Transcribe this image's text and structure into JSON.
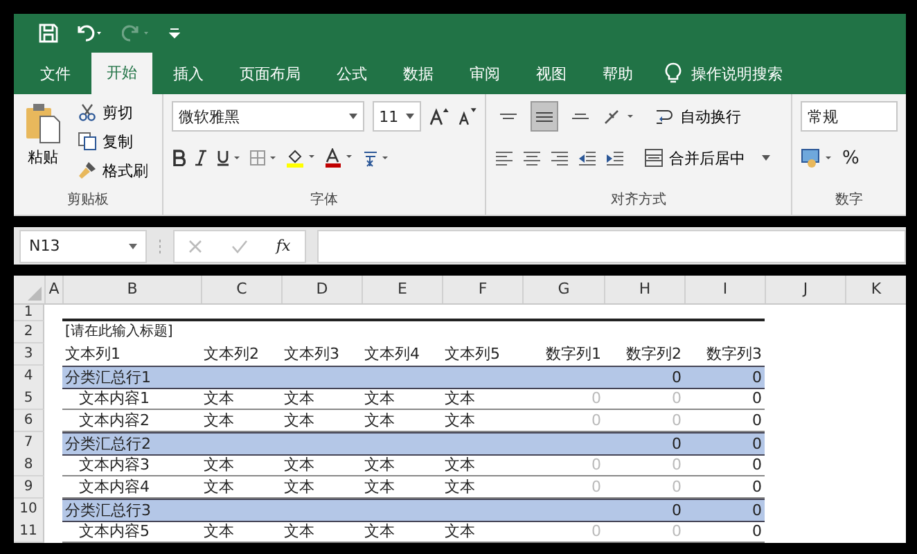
{
  "quick_access": {
    "redo_disabled": true
  },
  "tabs": [
    {
      "label": "文件",
      "selected": false
    },
    {
      "label": "开始",
      "selected": true
    },
    {
      "label": "插入",
      "selected": false
    },
    {
      "label": "页面布局",
      "selected": false
    },
    {
      "label": "公式",
      "selected": false
    },
    {
      "label": "数据",
      "selected": false
    },
    {
      "label": "审阅",
      "selected": false
    },
    {
      "label": "视图",
      "selected": false
    },
    {
      "label": "帮助",
      "selected": false
    }
  ],
  "tell_me": "操作说明搜索",
  "clipboard": {
    "paste": "粘贴",
    "cut": "剪切",
    "copy": "复制",
    "format_painter": "格式刷",
    "label": "剪贴板"
  },
  "font": {
    "name": "微软雅黑",
    "size": "11",
    "label": "字体"
  },
  "alignment": {
    "vertical": [
      {
        "kind": "top",
        "selected": false
      },
      {
        "kind": "middle",
        "selected": true
      },
      {
        "kind": "bottom",
        "selected": false
      }
    ],
    "wrap": "自动换行",
    "merge": "合并后居中",
    "label": "对齐方式"
  },
  "number": {
    "format": "常规",
    "percent": "%",
    "label": "数字"
  },
  "formula_bar": {
    "name_box": "N13",
    "fx": "fx"
  },
  "columns": [
    "A",
    "B",
    "C",
    "D",
    "E",
    "F",
    "G",
    "H",
    "I",
    "J",
    "K"
  ],
  "rows": [
    {
      "number": "1",
      "kind": "blank",
      "cells": []
    },
    {
      "number": "2",
      "kind": "title",
      "cells": [
        {
          "text": "[请在此输入标题]"
        }
      ]
    },
    {
      "number": "3",
      "kind": "header",
      "cells": [
        {
          "text": "文本列1"
        },
        {
          "text": "文本列2"
        },
        {
          "text": "文本列3"
        },
        {
          "text": "文本列4"
        },
        {
          "text": "文本列5"
        },
        {
          "text": "数字列1"
        },
        {
          "text": "数字列2"
        },
        {
          "text": "数字列3"
        }
      ]
    },
    {
      "number": "4",
      "kind": "subtotal",
      "cells": [
        {
          "text": "分类汇总行1"
        },
        {},
        {},
        {},
        {},
        {},
        {
          "text": "0"
        },
        {
          "text": "0"
        }
      ]
    },
    {
      "number": "5",
      "kind": "detail",
      "cells": [
        {
          "text": "文本内容1"
        },
        {
          "text": "文本"
        },
        {
          "text": "文本"
        },
        {
          "text": "文本"
        },
        {
          "text": "文本"
        },
        {
          "text": "0",
          "faded": true
        },
        {
          "text": "0",
          "faded": true
        },
        {
          "text": "0"
        }
      ]
    },
    {
      "number": "6",
      "kind": "detail",
      "cells": [
        {
          "text": "文本内容2"
        },
        {
          "text": "文本"
        },
        {
          "text": "文本"
        },
        {
          "text": "文本"
        },
        {
          "text": "文本"
        },
        {
          "text": "0",
          "faded": true
        },
        {
          "text": "0",
          "faded": true
        },
        {
          "text": "0"
        }
      ]
    },
    {
      "number": "7",
      "kind": "subtotal",
      "cells": [
        {
          "text": "分类汇总行2"
        },
        {},
        {},
        {},
        {},
        {},
        {
          "text": "0"
        },
        {
          "text": "0"
        }
      ]
    },
    {
      "number": "8",
      "kind": "detail",
      "cells": [
        {
          "text": "文本内容3"
        },
        {
          "text": "文本"
        },
        {
          "text": "文本"
        },
        {
          "text": "文本"
        },
        {
          "text": "文本"
        },
        {
          "text": "0",
          "faded": true
        },
        {
          "text": "0",
          "faded": true
        },
        {
          "text": "0"
        }
      ]
    },
    {
      "number": "9",
      "kind": "detail",
      "cells": [
        {
          "text": "文本内容4"
        },
        {
          "text": "文本"
        },
        {
          "text": "文本"
        },
        {
          "text": "文本"
        },
        {
          "text": "文本"
        },
        {
          "text": "0",
          "faded": true
        },
        {
          "text": "0",
          "faded": true
        },
        {
          "text": "0"
        }
      ]
    },
    {
      "number": "10",
      "kind": "subtotal",
      "cells": [
        {
          "text": "分类汇总行3"
        },
        {},
        {},
        {},
        {},
        {},
        {
          "text": "0"
        },
        {
          "text": "0"
        }
      ]
    },
    {
      "number": "11",
      "kind": "detail",
      "cells": [
        {
          "text": "文本内容5"
        },
        {
          "text": "文本"
        },
        {
          "text": "文本"
        },
        {
          "text": "文本"
        },
        {
          "text": "文本"
        },
        {
          "text": "0",
          "faded": true
        },
        {
          "text": "0",
          "faded": true
        },
        {
          "text": "0"
        }
      ]
    }
  ]
}
